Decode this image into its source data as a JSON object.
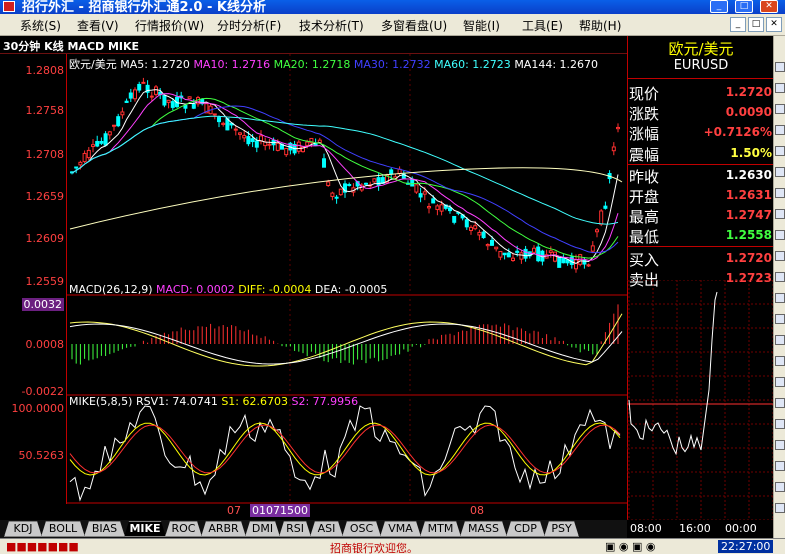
{
  "window": {
    "title": "招行外汇 - 招商银行外汇通2.0 - K线分析"
  },
  "menu": {
    "items": [
      "系统(S)",
      "查看(V)",
      "行情报价(W)",
      "分时分析(F)",
      "技术分析(T)",
      "多窗看盘(U)",
      "智能(I)",
      "工具(E)",
      "帮助(H)"
    ]
  },
  "chart_header": {
    "title": "30分钟 K线 MACD MIKE"
  },
  "main_pane": {
    "symbol": "欧元/美元",
    "ma_legend": [
      {
        "label": "MA5: 1.2720",
        "color": "#ffffff"
      },
      {
        "label": "MA10: 1.2716",
        "color": "#ff40ff"
      },
      {
        "label": "MA20: 1.2718",
        "color": "#40ff40"
      },
      {
        "label": "MA30: 1.2732",
        "color": "#4040ff"
      },
      {
        "label": "MA60: 1.2723",
        "color": "#40ffff"
      },
      {
        "label": "MA144: 1.2670",
        "color": "#ffffff"
      }
    ],
    "y_labels": [
      "1.2808",
      "1.2758",
      "1.2708",
      "1.2659",
      "1.2609",
      "1.2559"
    ]
  },
  "macd_pane": {
    "legend": [
      {
        "label": "MACD(26,12,9)",
        "color": "#ffffff"
      },
      {
        "label": "MACD: 0.0002",
        "color": "#ff40ff"
      },
      {
        "label": "DIFF: -0.0004",
        "color": "#ffff00"
      },
      {
        "label": "DEA: -0.0005",
        "color": "#ffffff"
      }
    ],
    "y_labels": [
      "0.0032",
      "0.0008",
      "-0.0022"
    ]
  },
  "mike_pane": {
    "legend": [
      {
        "label": "MIKE(5,8,5)",
        "color": "#ffffff"
      },
      {
        "label": "RSV1: 74.0741",
        "color": "#ffffff"
      },
      {
        "label": "S1: 62.6703",
        "color": "#ffff00"
      },
      {
        "label": "S2: 77.9956",
        "color": "#ff40ff"
      }
    ],
    "y_labels": [
      "100.0000",
      "50.5263"
    ]
  },
  "x_axis": {
    "labels": [
      "07",
      "08"
    ],
    "highlight": "01071500"
  },
  "indicator_tabs": [
    "KDJ",
    "BOLL",
    "BIAS",
    "MIKE",
    "ROC",
    "ARBR",
    "DMI",
    "RSI",
    "ASI",
    "OSC",
    "VMA",
    "MTM",
    "MASS",
    "CDP",
    "PSY"
  ],
  "active_tab": "MIKE",
  "quote_panel": {
    "name": "欧元/美元",
    "code": "EURUSD",
    "rows": [
      {
        "key": "现价",
        "value": "1.2720",
        "color": "#ff4040"
      },
      {
        "key": "涨跌",
        "value": "0.0090",
        "color": "#ff4040"
      },
      {
        "key": "涨幅",
        "value": "+0.7126%",
        "color": "#ff4040"
      },
      {
        "key": "震幅",
        "value": "1.50%",
        "color": "#ffff40"
      },
      {
        "key": "昨收",
        "value": "1.2630",
        "color": "#ffffff"
      },
      {
        "key": "开盘",
        "value": "1.2631",
        "color": "#ff4040"
      },
      {
        "key": "最高",
        "value": "1.2747",
        "color": "#ff4040"
      },
      {
        "key": "最低",
        "value": "1.2558",
        "color": "#40ff40"
      },
      {
        "key": "买入",
        "value": "1.2720",
        "color": "#ff4040"
      },
      {
        "key": "卖出",
        "value": "1.2723",
        "color": "#ff4040"
      }
    ]
  },
  "mini_chart": {
    "x_labels": [
      "08:00",
      "16:00",
      "00:00"
    ]
  },
  "status_bar": {
    "message": "招商银行欢迎您。",
    "time": "22:27:00"
  },
  "colors": {
    "axis": "#c00000",
    "up": "#ff3030",
    "down": "#00ffff"
  }
}
